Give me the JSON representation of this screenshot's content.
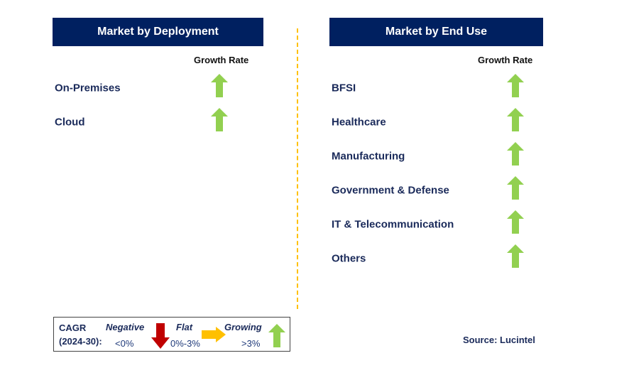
{
  "colors": {
    "header_bg": "#002060",
    "up_arrow": "#92D050",
    "down_arrow": "#C00000",
    "flat_arrow": "#FFC000",
    "divider": "#FFC000"
  },
  "left": {
    "title": "Market by Deployment",
    "column": "Growth Rate",
    "items": [
      {
        "label": "On-Premises",
        "trend": "growing"
      },
      {
        "label": "Cloud",
        "trend": "growing"
      }
    ]
  },
  "right": {
    "title": "Market by End Use",
    "column": "Growth Rate",
    "items": [
      {
        "label": "BFSI",
        "trend": "growing"
      },
      {
        "label": "Healthcare",
        "trend": "growing"
      },
      {
        "label": "Manufacturing",
        "trend": "growing"
      },
      {
        "label": "Government & Defense",
        "trend": "growing"
      },
      {
        "label": "IT & Telecommunication",
        "trend": "growing"
      },
      {
        "label": "Others",
        "trend": "growing"
      }
    ]
  },
  "legend": {
    "cagr": "CAGR",
    "period": "(2024-30):",
    "negative": "Negative",
    "negative_range": "<0%",
    "flat": "Flat",
    "flat_range": "0%-3%",
    "growing": "Growing",
    "growing_range": ">3%"
  },
  "source": "Source: Lucintel"
}
